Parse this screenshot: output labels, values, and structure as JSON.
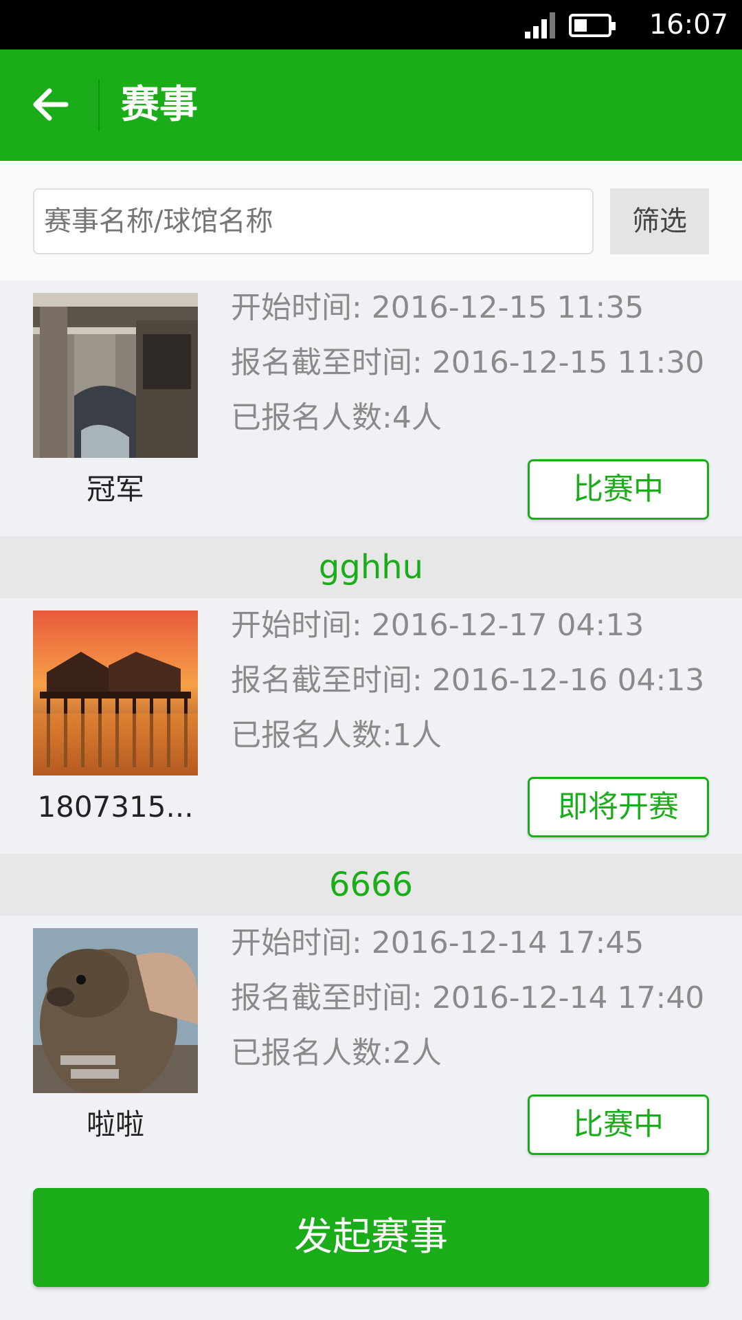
{
  "status_bar": {
    "time": "16:07"
  },
  "app_bar": {
    "title": "赛事",
    "back_icon": "arrow-left-icon"
  },
  "search": {
    "placeholder": "赛事名称/球馆名称",
    "filter_label": "筛选"
  },
  "events": [
    {
      "name": "",
      "image": "old-wooden-village-photo",
      "caption": "冠军",
      "start": "开始时间: 2016-12-15 11:35",
      "deadline": "报名截至时间: 2016-12-15 11:30",
      "count": "已报名人数:4人",
      "status": "比赛中"
    },
    {
      "name": "gghhu",
      "image": "sunset-pier-house-photo",
      "caption": "1807315...",
      "start": "开始时间: 2016-12-17 04:13",
      "deadline": "报名截至时间: 2016-12-16 04:13",
      "count": "已报名人数:1人",
      "status": "即将开赛"
    },
    {
      "name": "6666",
      "image": "groundhog-meme-photo",
      "caption": "啦啦",
      "start": "开始时间: 2016-12-14 17:45",
      "deadline": "报名截至时间: 2016-12-14 17:40",
      "count": "已报名人数:2人",
      "status": "比赛中"
    }
  ],
  "launch_button": "发起赛事",
  "colors": {
    "primary": "#1aad19",
    "background": "#f0f1f5"
  }
}
